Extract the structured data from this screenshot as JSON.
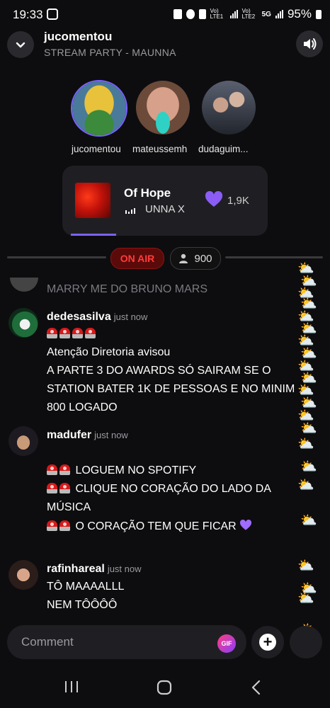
{
  "status_bar": {
    "time": "19:33",
    "signal1_label": "Vo) LTE1",
    "signal2_label": "Vo) LTE2",
    "network": "5G",
    "battery": "95%"
  },
  "header": {
    "title": "jucomentou",
    "subtitle": "STREAM PARTY - MAUNNA"
  },
  "participants": [
    {
      "name": "jucomentou"
    },
    {
      "name": "mateussemh"
    },
    {
      "name": "dudaguim..."
    }
  ],
  "now_playing": {
    "song": "Of Hope",
    "artist": "UNNA X",
    "likes": "1,9K",
    "progress": 0.22
  },
  "live": {
    "on_air": "ON AIR",
    "viewers": "900"
  },
  "chat": {
    "faded_line": "MARRY ME DO BRUNO MARS",
    "messages": [
      {
        "user": "dedesasilva",
        "time": "just now",
        "lines": [
          "Atenção Diretoria avisou",
          "A PARTE 3 DO AWARDS SÓ SAIRAM SE O",
          "STATION BATER 1K DE PESSOAS E NO MINIM",
          "800 LOGADO"
        ]
      },
      {
        "user": "madufer",
        "time": "just now",
        "lines": [
          "LOGUEM NO SPOTIFY",
          "CLIQUE NO CORAÇÃO DO LADO DA",
          "MÚSICA",
          "O CORAÇÃO TEM QUE FICAR"
        ]
      },
      {
        "user": "rafinhareal",
        "time": "just now",
        "lines": [
          "TÔ MAAAALLL",
          "NEM TÔÔÔÔ"
        ]
      }
    ]
  },
  "comment": {
    "placeholder": "Comment",
    "gif_label": "GIF",
    "add_label": "+"
  },
  "icons": {
    "clouds": "sun-behind-cloud-emoji",
    "siren": "police-light-emoji",
    "heart": "purple-heart-emoji"
  },
  "colors": {
    "accent": "#7b61ff",
    "on_air": "#ff3b3b",
    "heart": "#a06bff"
  }
}
